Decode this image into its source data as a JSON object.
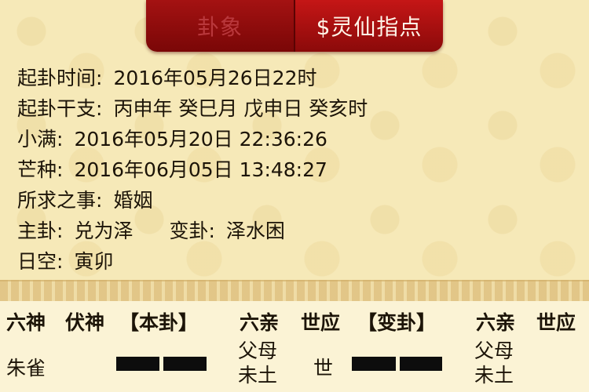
{
  "tabs": [
    {
      "label": "卦象",
      "active": false
    },
    {
      "label": "$灵仙指点",
      "active": true
    }
  ],
  "info": {
    "qigua_time_label": "起卦时间:",
    "qigua_time_value": "2016年05月26日22时",
    "ganzhi_label": "起卦干支:",
    "ganzhi_value": "丙申年 癸巳月 戊申日 癸亥时",
    "xiaoman_label": "小满:",
    "xiaoman_value": "2016年05月20日 22:36:26",
    "mangzhong_label": "芒种:",
    "mangzhong_value": "2016年06月05日 13:48:27",
    "matter_label": "所求之事:",
    "matter_value": "婚姻",
    "main_gua_label": "主卦:",
    "main_gua_value": "兑为泽",
    "changed_gua_label": "变卦:",
    "changed_gua_value": "泽水困",
    "rikong_label": "日空:",
    "rikong_value": "寅卯"
  },
  "table": {
    "headers": {
      "liushen": "六神",
      "fushen": "伏神",
      "bengua": "【本卦】",
      "liuqin": "六亲",
      "shiying": "世应",
      "biangua": "【变卦】",
      "liuqin2": "六亲",
      "shiying2": "世应"
    },
    "row1": {
      "liushen": "朱雀",
      "liuqin_line1": "父母",
      "liuqin_line2": "未土",
      "shiying": "世",
      "liuqin2_line1": "父母",
      "liuqin2_line2": "未土"
    }
  },
  "colors": {
    "tab_active_bg": "#c51616",
    "tab_inactive_text": "#b9383c",
    "background": "#f6e9b8"
  }
}
